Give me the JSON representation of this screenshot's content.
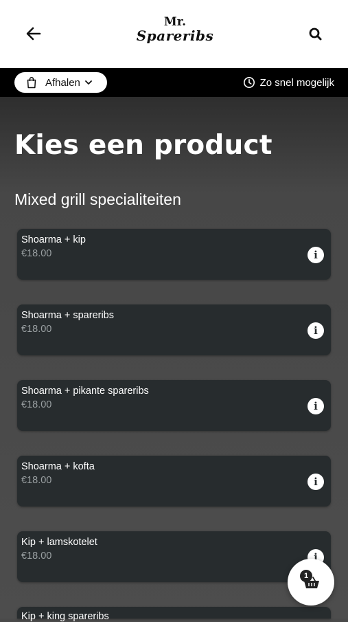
{
  "header": {
    "logo_top": "Mr.",
    "logo_brand": "Spareribs"
  },
  "order_bar": {
    "mode_label": "Afhalen",
    "time_label": "Zo snel mogelijk"
  },
  "main": {
    "title": "Kies een product",
    "section_title": "Mixed grill specialiteiten",
    "products": [
      {
        "name": "Shoarma + kip",
        "price": "€18.00"
      },
      {
        "name": "Shoarma + spareribs",
        "price": "€18.00"
      },
      {
        "name": "Shoarma + pikante spareribs",
        "price": "€18.00"
      },
      {
        "name": "Shoarma + kofta",
        "price": "€18.00"
      },
      {
        "name": "Kip + lamskotelet",
        "price": "€18.00"
      },
      {
        "name": "Kip + king spareribs",
        "price": ""
      }
    ]
  },
  "cart": {
    "count": "1"
  },
  "icons": [
    "arrow-left-icon",
    "search-icon",
    "shopping-bag-icon",
    "chevron-down-icon",
    "clock-icon",
    "info-icon",
    "basket-icon"
  ],
  "colors": {
    "header_bg": "#ffffff",
    "subbar_bg": "#000000",
    "card_bg": "#272c2e",
    "price_text": "#9aa0a2"
  }
}
